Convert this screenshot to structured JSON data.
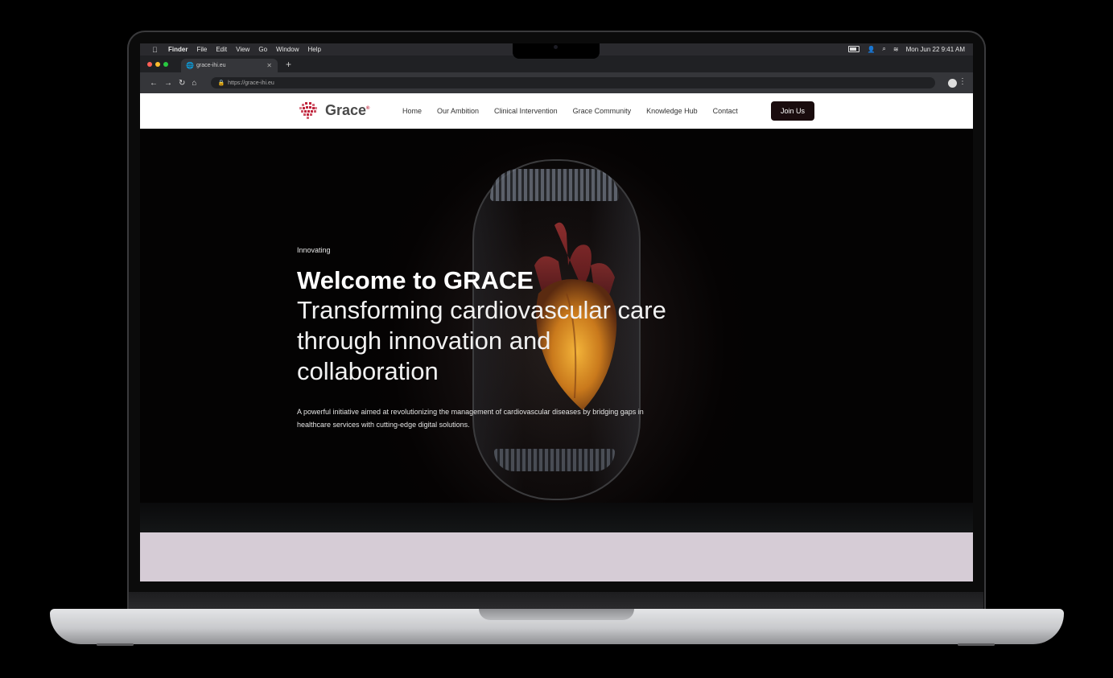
{
  "menubar": {
    "app": "Finder",
    "items": [
      "File",
      "Edit",
      "View",
      "Go",
      "Window",
      "Help"
    ],
    "datetime": "Mon Jun 22  9:41 AM",
    "icons": [
      "apple-icon",
      "battery-icon",
      "user-icon",
      "search-icon",
      "wifi-icon"
    ]
  },
  "browser": {
    "tab_title": "grace-ihi.eu",
    "url": "https://grace-ihi.eu",
    "traffic_colors": [
      "#ff5f57",
      "#febc2e",
      "#28c840"
    ]
  },
  "site": {
    "logo_text": "Grace",
    "logo_mark_sup": "®",
    "nav": [
      "Home",
      "Our Ambition",
      "Clinical Intervention",
      "Grace Community",
      "Knowledge Hub",
      "Contact"
    ],
    "cta": "Join Us",
    "brand_color": "#c0243c"
  },
  "hero": {
    "eyebrow": "Innovating",
    "title": "Welcome to GRACE",
    "subtitle": "Transforming cardiovascular care through innovation and collaboration",
    "description": "A powerful initiative aimed at revolutionizing the management of cardiovascular diseases by bridging gaps in healthcare services with cutting-edge digital solutions."
  }
}
